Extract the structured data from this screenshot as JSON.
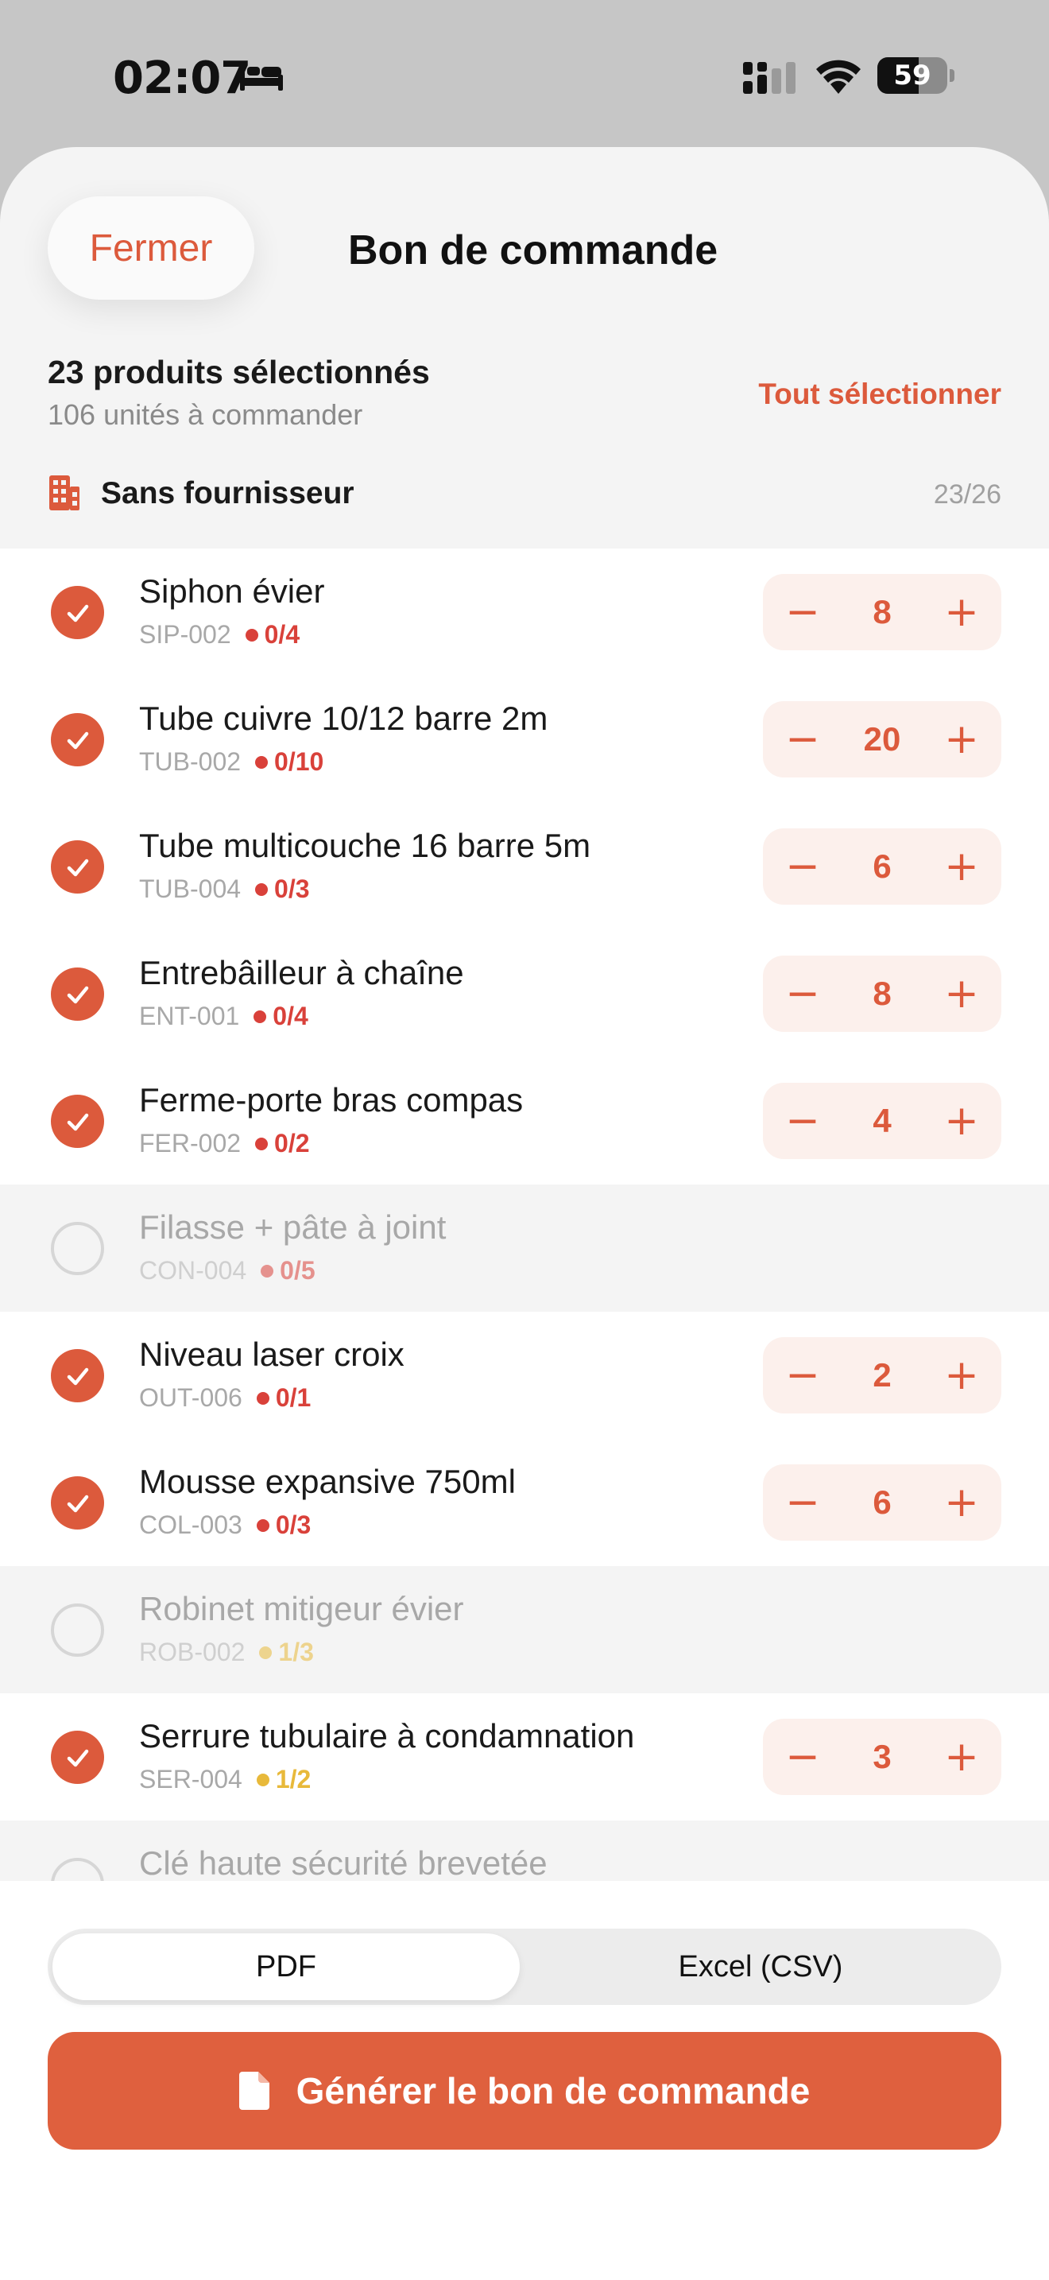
{
  "status_bar": {
    "time": "02:07",
    "battery": "59",
    "battery_level_percent": 59,
    "icons": [
      "bed-icon",
      "cellular-signal-icon",
      "wifi-icon",
      "battery-icon"
    ]
  },
  "sheet": {
    "close_label": "Fermer",
    "title": "Bon de commande",
    "selected_count": "23 produits sélectionnés",
    "units_to_order": "106 unités à commander",
    "select_all_label": "Tout sélectionner",
    "supplier": {
      "icon": "building-icon",
      "name": "Sans fournisseur",
      "count": "23/26"
    }
  },
  "colors": {
    "accent": "#dc5a3c",
    "stock_critical": "#d9413a",
    "stock_low": "#e8b93a",
    "stepper_bg": "#fcf0ec"
  },
  "products": [
    {
      "name": "Siphon évier",
      "code": "SIP-002",
      "stock": "0/4",
      "stock_color": "#d9413a",
      "selected": true,
      "qty": "8"
    },
    {
      "name": "Tube cuivre 10/12 barre 2m",
      "code": "TUB-002",
      "stock": "0/10",
      "stock_color": "#d9413a",
      "selected": true,
      "qty": "20"
    },
    {
      "name": "Tube multicouche 16 barre 5m",
      "code": "TUB-004",
      "stock": "0/3",
      "stock_color": "#d9413a",
      "selected": true,
      "qty": "6"
    },
    {
      "name": "Entrebâilleur à chaîne",
      "code": "ENT-001",
      "stock": "0/4",
      "stock_color": "#d9413a",
      "selected": true,
      "qty": "8"
    },
    {
      "name": "Ferme-porte bras compas",
      "code": "FER-002",
      "stock": "0/2",
      "stock_color": "#d9413a",
      "selected": true,
      "qty": "4"
    },
    {
      "name": "Filasse + pâte à joint",
      "code": "CON-004",
      "stock": "0/5",
      "stock_color": "#d9413a",
      "selected": false,
      "qty": ""
    },
    {
      "name": "Niveau laser croix",
      "code": "OUT-006",
      "stock": "0/1",
      "stock_color": "#d9413a",
      "selected": true,
      "qty": "2"
    },
    {
      "name": "Mousse expansive 750ml",
      "code": "COL-003",
      "stock": "0/3",
      "stock_color": "#d9413a",
      "selected": true,
      "qty": "6"
    },
    {
      "name": "Robinet mitigeur évier",
      "code": "ROB-002",
      "stock": "1/3",
      "stock_color": "#e8b93a",
      "selected": false,
      "qty": ""
    },
    {
      "name": "Serrure tubulaire à condamnation",
      "code": "SER-004",
      "stock": "1/2",
      "stock_color": "#e8b93a",
      "selected": true,
      "qty": "3"
    },
    {
      "name": "Clé haute sécurité brevetée",
      "code": "",
      "stock": "",
      "stock_color": "#d9413a",
      "selected": false,
      "qty": ""
    }
  ],
  "stepper": {
    "minus": "−",
    "plus": "+"
  },
  "footer": {
    "format_options": [
      "PDF",
      "Excel (CSV)"
    ],
    "selected_format": "PDF",
    "generate_label": "Générer le bon de commande",
    "generate_icon": "document-icon"
  }
}
